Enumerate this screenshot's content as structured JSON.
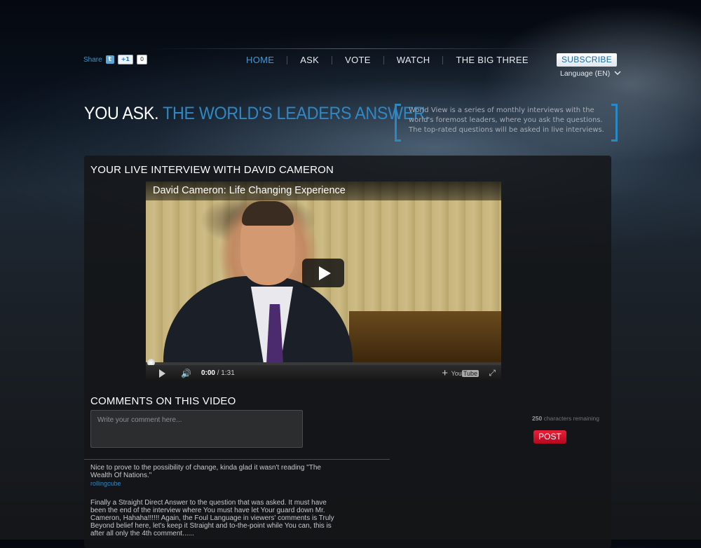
{
  "header": {
    "share_label": "Share",
    "twitter_glyph": "t",
    "gplus_label": "+1",
    "gplus_count": "0",
    "nav": [
      {
        "label": "HOME",
        "active": true
      },
      {
        "label": "ASK",
        "active": false
      },
      {
        "label": "VOTE",
        "active": false
      },
      {
        "label": "WATCH",
        "active": false
      },
      {
        "label": "THE BIG THREE",
        "active": false
      }
    ],
    "subscribe_label": "SUBSCRIBE",
    "language_label": "Language (EN)"
  },
  "hero": {
    "part1": "YOU ASK.",
    "part2": "THE WORLD'S LEADERS ANSWER.",
    "intro": "World View is a series of monthly interviews with the world's foremost leaders, where you ask the questions. The top-rated questions will be asked in live interviews."
  },
  "interview": {
    "title": "YOUR LIVE INTERVIEW WITH DAVID CAMERON",
    "video": {
      "title": "David Cameron: Life Changing Experience",
      "current_time": "0:00",
      "duration": "/ 1:31",
      "progress": 0,
      "brand_you": "You",
      "brand_tube": "Tube"
    }
  },
  "comments": {
    "title": "COMMENTS ON THIS VIDEO",
    "placeholder": "Write your comment here...",
    "chars_count": "250",
    "chars_label": "characters remaining",
    "post_label": "POST",
    "items": [
      {
        "text": "Nice to prove to the possibility of change, kinda glad it wasn't reading \"The Wealth Of Nations.\"",
        "user": "rollingcube"
      },
      {
        "text": "Finally a Straight Direct Answer to the question that was asked. It must have been the end of the interview where You must have let Your guard down Mr. Cameron, Hahaha!!!!!! Again, the Foul Language in viewers' comments is Truly Beyond belief here, let's keep it Straight and to-the-point while You can, this is after all only the 4th comment......",
        "user": ""
      }
    ]
  },
  "colors": {
    "accent": "#2f88c4",
    "post_red": "#d3142c",
    "nav_active": "#3d9ad8"
  }
}
